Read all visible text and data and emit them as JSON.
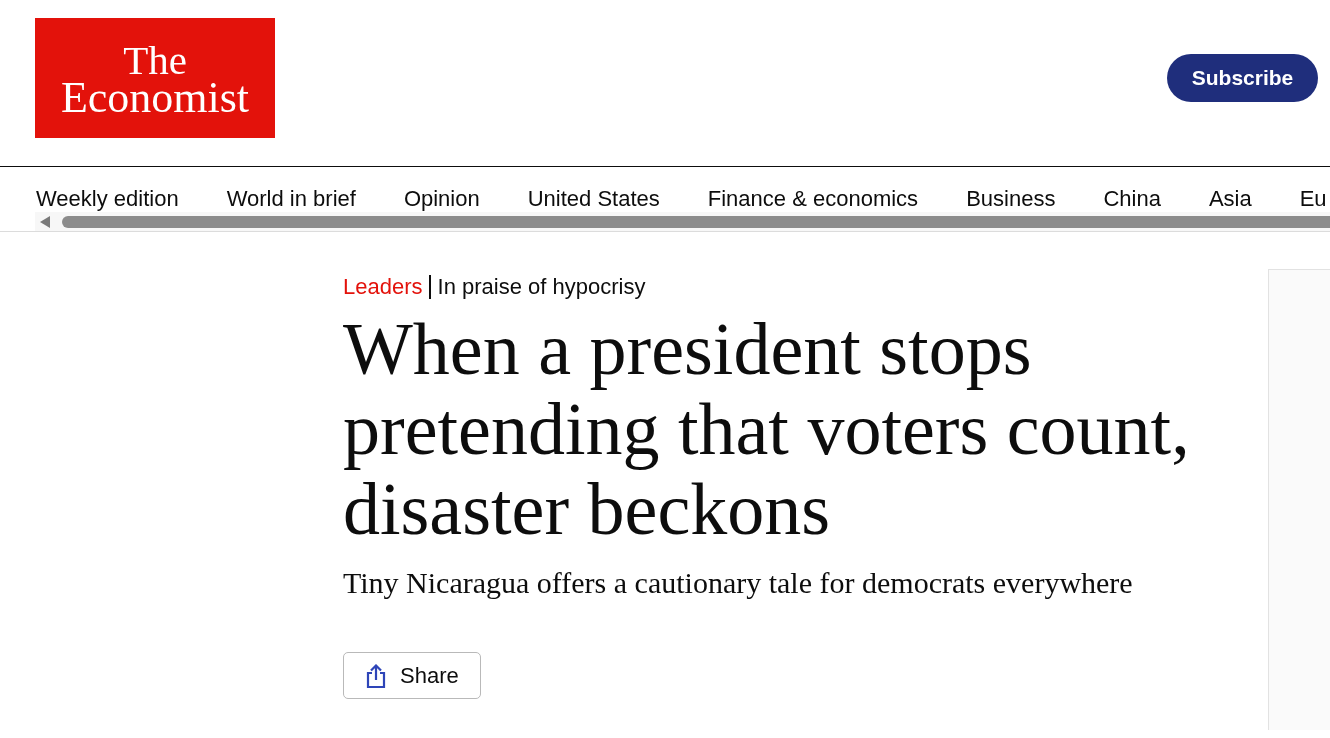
{
  "header": {
    "logo": {
      "lines": [
        "The",
        "Economist"
      ]
    },
    "subscribe_button": "Subscribe"
  },
  "nav": {
    "items": [
      "Weekly edition",
      "World in brief",
      "Opinion",
      "United States",
      "Finance & economics",
      "Business",
      "China",
      "Asia",
      "Eu"
    ]
  },
  "article": {
    "section": "Leaders",
    "fly_title": "In praise of hypocrisy",
    "headline": "When a president stops pretending that voters count, disaster beckons",
    "subtitle": "Tiny Nicaragua offers a cautionary tale for democrats everywhere",
    "share_button": "Share"
  }
}
